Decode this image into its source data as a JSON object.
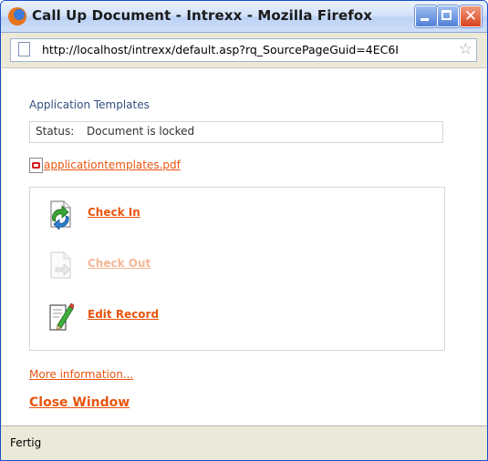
{
  "window": {
    "title": "Call Up Document - Intrexx - Mozilla Firefox",
    "controls": [
      "minimize-icon",
      "maximize-icon",
      "close-icon"
    ],
    "close_glyph": "✕"
  },
  "address_bar": {
    "url": "http://localhost/intrexx/default.asp?rq_SourcePageGuid=4EC6I",
    "bookmark_star": "☆"
  },
  "document": {
    "app_title": "Application Templates",
    "status_label": "Status:",
    "status_value": "Document is locked",
    "file_link": "applicationtemplates.pdf",
    "actions": [
      {
        "label": "Check In",
        "icon": "check-in-icon",
        "enabled": true
      },
      {
        "label": "Check Out",
        "icon": "check-out-icon",
        "enabled": false
      },
      {
        "label": "Edit Record",
        "icon": "edit-record-icon",
        "enabled": true
      }
    ],
    "more_info": "More information...",
    "close_window": "Close Window"
  },
  "status_bar": {
    "text": "Fertig"
  },
  "colors": {
    "link": "#e8550f",
    "link_disabled": "#f2b795",
    "heading": "#33507f"
  }
}
